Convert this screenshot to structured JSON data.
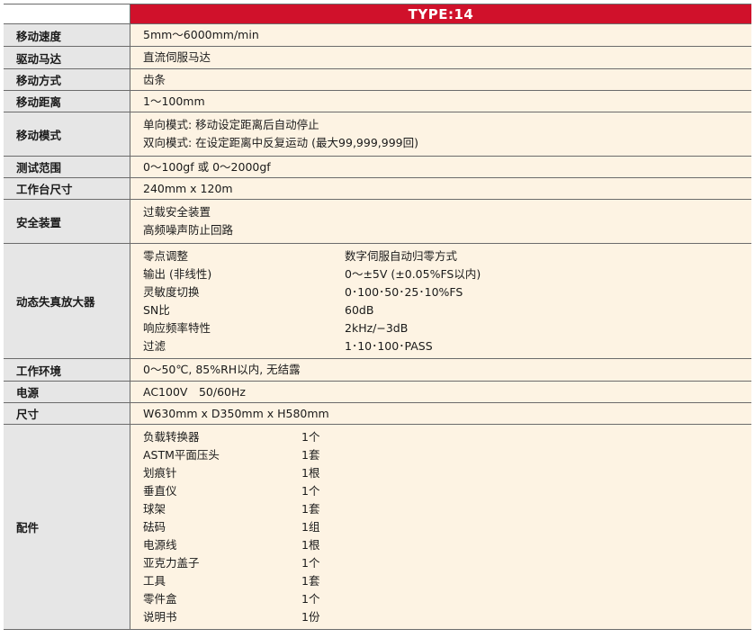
{
  "header": {
    "type_label": "TYPE:14"
  },
  "rows": {
    "speed": {
      "label": "移动速度",
      "value": "5mm～6000mm/min"
    },
    "motor": {
      "label": "驱动马达",
      "value": "直流伺服马达"
    },
    "method": {
      "label": "移动方式",
      "value": "齿条"
    },
    "distance": {
      "label": "移动距离",
      "value": "1～100mm"
    },
    "mode": {
      "label": "移动模式",
      "lines": [
        "单向模式: 移动设定距离后自动停止",
        "双向模式: 在设定距离中反复运动 (最大99,999,999回)"
      ]
    },
    "range": {
      "label": "测试范围",
      "value": "0～100gf 或 0～2000gf"
    },
    "table_size": {
      "label": "工作台尺寸",
      "value": "240mm x 120m"
    },
    "safety": {
      "label": "安全装置",
      "lines": [
        "过载安全装置",
        "高频噪声防止回路"
      ]
    },
    "amplifier": {
      "label": "动态失真放大器",
      "items": [
        {
          "name": "零点调整",
          "value": "数字伺服自动归零方式"
        },
        {
          "name": "输出 (非线性)",
          "value": "0～±5V (±0.05%FS以内)"
        },
        {
          "name": "灵敏度切换",
          "value": "0･100･50･25･10%FS"
        },
        {
          "name": "SN比",
          "value": "60dB"
        },
        {
          "name": "响应频率特性",
          "value": "2kHz/−3dB"
        },
        {
          "name": "过滤",
          "value": "1･10･100･PASS"
        }
      ]
    },
    "environment": {
      "label": "工作环境",
      "value": "0～50℃, 85%RH以内, 无结露"
    },
    "power": {
      "label": "电源",
      "value": "AC100V　50/60Hz"
    },
    "dimensions": {
      "label": "尺寸",
      "value": "W630mm x D350mm x H580mm"
    },
    "accessories": {
      "label": "配件",
      "items": [
        {
          "name": "负载转换器",
          "qty": "1个"
        },
        {
          "name": "ASTM平面压头",
          "qty": "1套"
        },
        {
          "name": "划痕针",
          "qty": "1根"
        },
        {
          "name": "垂直仪",
          "qty": "1个"
        },
        {
          "name": "球架",
          "qty": "1套"
        },
        {
          "name": "砝码",
          "qty": "1组"
        },
        {
          "name": "电源线",
          "qty": "1根"
        },
        {
          "name": "亚克力盖子",
          "qty": "1个"
        },
        {
          "name": "工具",
          "qty": "1套"
        },
        {
          "name": "零件盒",
          "qty": "1个"
        },
        {
          "name": "说明书",
          "qty": "1份"
        }
      ]
    }
  },
  "colors": {
    "header_red": "#d0112b",
    "label_bg": "#e6e6e6",
    "value_bg": "#fdf3e3"
  }
}
